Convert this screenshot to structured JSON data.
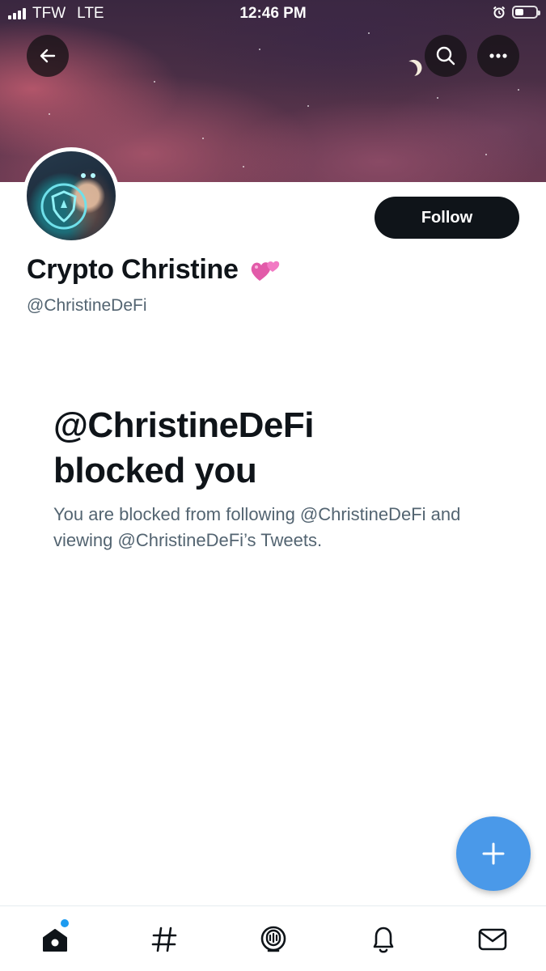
{
  "status_bar": {
    "carrier": "TFW",
    "network": "LTE",
    "time": "12:46 PM"
  },
  "header": {
    "back_icon": "arrow-left-icon",
    "search_icon": "search-icon",
    "more_icon": "more-horizontal-icon"
  },
  "profile": {
    "display_name": "Crypto Christine",
    "name_emoji": "💞",
    "handle": "@ChristineDeFi",
    "follow_label": "Follow"
  },
  "blocked": {
    "title_line1": "@ChristineDeFi",
    "title_line2": "blocked you",
    "description": "You are blocked from following @ChristineDeFi and viewing @ChristineDeFi’s Tweets."
  },
  "fab": {
    "icon": "plus-icon"
  },
  "tab_bar": {
    "items": [
      {
        "name": "home",
        "icon": "home-icon",
        "has_dot": true
      },
      {
        "name": "explore",
        "icon": "hashtag-icon"
      },
      {
        "name": "spaces",
        "icon": "spaces-icon"
      },
      {
        "name": "notifications",
        "icon": "bell-icon"
      },
      {
        "name": "messages",
        "icon": "mail-icon"
      }
    ]
  },
  "colors": {
    "accent": "#1d9bf0",
    "fab": "#4a99e9",
    "text_primary": "#0f1419",
    "text_secondary": "#536471"
  }
}
